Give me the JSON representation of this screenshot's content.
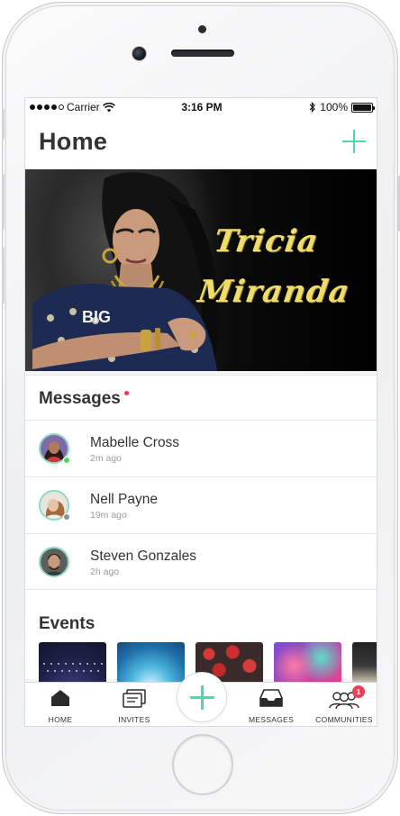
{
  "status_bar": {
    "carrier": "Carrier",
    "time": "3:16 PM",
    "battery": "100%",
    "battery_level": 1.0,
    "signal_bars": 4
  },
  "header": {
    "title": "Home",
    "add_icon": "plus-icon"
  },
  "banner": {
    "line1": "Tricia",
    "line2": "Miranda",
    "title_color": "#f0dc6a"
  },
  "messages": {
    "title": "Messages",
    "items": [
      {
        "name": "Mabelle Cross",
        "time": "2m ago",
        "presence_color": "#4cd964"
      },
      {
        "name": "Nell Payne",
        "time": "19m ago",
        "presence_color": "#8e8e93"
      },
      {
        "name": "Steven Gonzales",
        "time": "2h ago"
      }
    ]
  },
  "events": {
    "title": "Events",
    "count": 5
  },
  "tabbar": {
    "items": [
      {
        "label": "HOME",
        "icon": "home-icon"
      },
      {
        "label": "INVITES",
        "icon": "invites-icon"
      },
      {
        "label": "",
        "icon": "plus-icon"
      },
      {
        "label": "MESSAGES",
        "icon": "inbox-icon"
      },
      {
        "label": "COMMUNITIES",
        "icon": "communities-icon",
        "badge": "1"
      }
    ]
  },
  "colors": {
    "accent": "#4fd6b0",
    "badge": "#f23c52",
    "avatar_ring": "#8ed9c3"
  }
}
